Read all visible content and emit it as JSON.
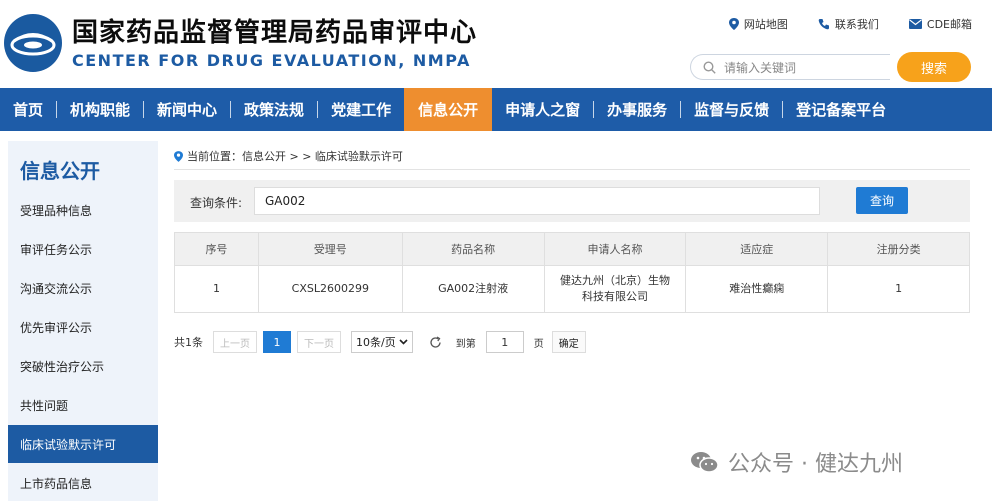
{
  "header": {
    "title_cn": "国家药品监督管理局药品审评中心",
    "title_en": "CENTER FOR DRUG EVALUATION, NMPA",
    "links": [
      "网站地图",
      "联系我们",
      "CDE邮箱"
    ],
    "search_placeholder": "请输入关键词",
    "search_button": "搜索"
  },
  "nav": {
    "items": [
      "首页",
      "机构职能",
      "新闻中心",
      "政策法规",
      "党建工作",
      "信息公开",
      "申请人之窗",
      "办事服务",
      "监督与反馈",
      "登记备案平台"
    ],
    "active_index": 5
  },
  "sidebar": {
    "title": "信息公开",
    "items": [
      "受理品种信息",
      "审评任务公示",
      "沟通交流公示",
      "优先审评公示",
      "突破性治疗公示",
      "共性问题",
      "临床试验默示许可",
      "上市药品信息"
    ],
    "active_index": 6
  },
  "breadcrumb": {
    "text": "当前位置：信息公开 > > 临床试验默示许可"
  },
  "query": {
    "label": "查询条件:",
    "value": "GA002",
    "button": "查询"
  },
  "table": {
    "headers": [
      "序号",
      "受理号",
      "药品名称",
      "申请人名称",
      "适应症",
      "注册分类"
    ],
    "rows": [
      [
        "1",
        "CXSL2600299",
        "GA002注射液",
        "健达九州（北京）生物科技有限公司",
        "难治性癫痫",
        "1"
      ]
    ]
  },
  "pager": {
    "total": "共1条",
    "prev": "上一页",
    "current": "1",
    "next": "下一页",
    "page_size": "10条/页",
    "goto_label": "到第",
    "goto_value": "1",
    "page_unit": "页",
    "confirm": "确定"
  },
  "watermark": {
    "text": "公众号 · 健达九州"
  },
  "colors": {
    "nav_bg": "#1e5ca8",
    "nav_active": "#ee8e2f",
    "search_button": "#f7a21b",
    "primary_button": "#1f7bd4",
    "sidebar_bg": "#eef3fa"
  }
}
